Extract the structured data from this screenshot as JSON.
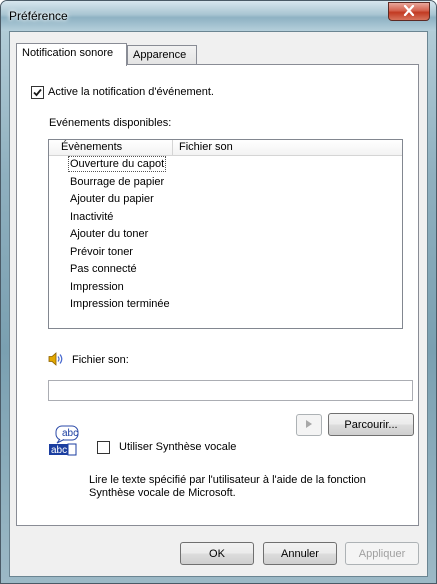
{
  "window": {
    "title": "Préférence"
  },
  "tabs": [
    {
      "label": "Notification sonore"
    },
    {
      "label": "Apparence"
    }
  ],
  "notification": {
    "enable_label": "Active la notification d'événement.",
    "enable_checked": true
  },
  "events": {
    "group_label": "Evénements disponibles:",
    "columns": [
      "Évènements",
      "Fichier son"
    ],
    "rows": [
      "Ouverture du capot",
      "Bourrage de papier",
      "Ajouter du papier",
      "Inactivité",
      "Ajouter du toner",
      "Prévoir toner",
      "Pas connecté",
      "Impression",
      "Impression terminée"
    ]
  },
  "sound_file": {
    "label": "Fichier son:",
    "value": "",
    "browse_label": "Parcourir..."
  },
  "tts": {
    "icon_text_top": "abc",
    "icon_text_bottom": "abc",
    "checkbox_label": "Utiliser Synthèse vocale",
    "checked": false,
    "description": "Lire le texte spécifié par l'utilisateur à l'aide de la fonction Synthèse vocale de Microsoft."
  },
  "footer": {
    "ok_label": "OK",
    "cancel_label": "Annuler",
    "apply_label": "Appliquer"
  },
  "colors": {
    "close_button": "#c8422a",
    "selection_outline": "#555555"
  },
  "icons": [
    "close-icon",
    "checkmark-icon",
    "speaker-icon",
    "play-icon",
    "text-to-speech-icon"
  ]
}
